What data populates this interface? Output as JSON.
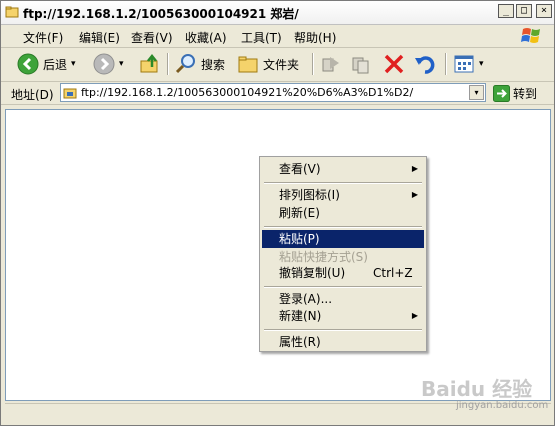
{
  "window": {
    "title": "ftp://192.168.1.2/100563000104921 郑岩/"
  },
  "title_buttons": [
    "_",
    "□",
    "×"
  ],
  "menubar": {
    "items": [
      "文件(F)",
      "编辑(E)",
      "查看(V)",
      "收藏(A)",
      "工具(T)",
      "帮助(H)"
    ]
  },
  "toolbar": {
    "back_label": "后退",
    "search_label": "搜索",
    "folders_label": "文件夹",
    "dropdown_glyph": "▾"
  },
  "address": {
    "label": "地址(D)",
    "value": "ftp://192.168.1.2/100563000104921%20%D6%A3%D1%D2/",
    "dropdown_glyph": "▾",
    "go_label": "转到"
  },
  "context_menu": {
    "submenu_glyph": "▶",
    "items": [
      {
        "label": "查看(V)",
        "submenu": true,
        "state": "normal"
      },
      {
        "label": "排列图标(I)",
        "submenu": true,
        "state": "normal"
      },
      {
        "label": "刷新(E)",
        "submenu": false,
        "state": "normal"
      },
      {
        "label": "粘贴(P)",
        "submenu": false,
        "state": "selected"
      },
      {
        "label": "粘贴快捷方式(S)",
        "submenu": false,
        "state": "disabled"
      },
      {
        "label": "撤销复制(U)",
        "submenu": false,
        "state": "normal",
        "shortcut": "Ctrl+Z"
      },
      {
        "label": "登录(A)...",
        "submenu": false,
        "state": "normal"
      },
      {
        "label": "新建(N)",
        "submenu": true,
        "state": "normal"
      },
      {
        "label": "属性(R)",
        "submenu": false,
        "state": "normal"
      }
    ]
  },
  "watermark": {
    "text": "Baidu 经验",
    "sub": "jingyan.baidu.com"
  },
  "colors": {
    "selection": "#0a246a",
    "chrome": "#ece9d8",
    "disabled_text": "#a5a193"
  },
  "icons": [
    "ftp-folder-icon",
    "back-arrow-icon",
    "forward-arrow-icon",
    "up-folder-icon",
    "search-icon",
    "folders-icon",
    "move-to-icon",
    "copy-to-icon",
    "delete-icon",
    "undo-icon",
    "views-icon",
    "windows-logo-icon",
    "go-arrow-icon"
  ]
}
